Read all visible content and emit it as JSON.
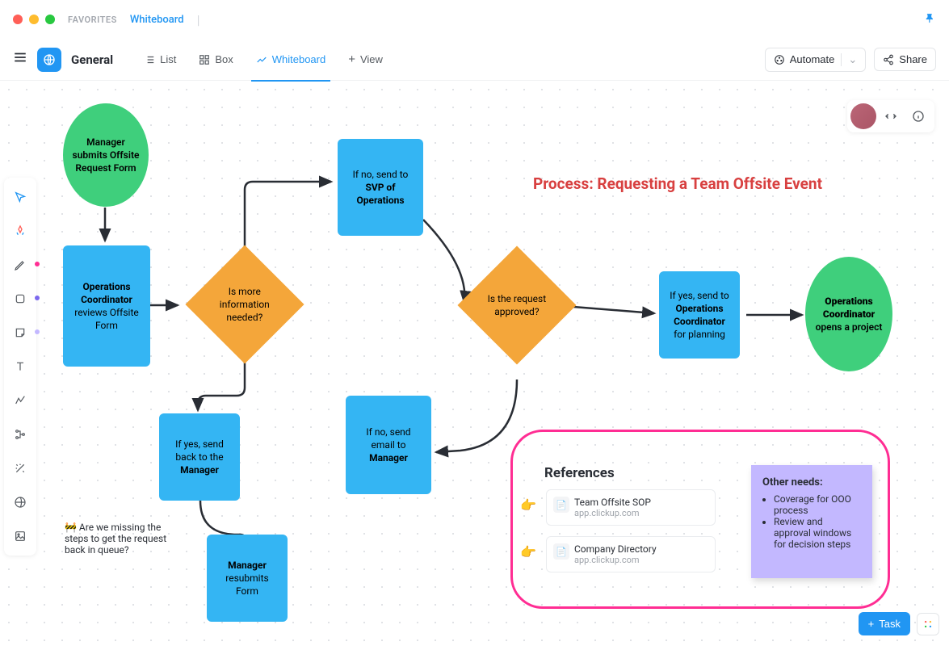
{
  "chrome": {
    "favorites": "FAVORITES",
    "tab": "Whiteboard"
  },
  "header": {
    "space": "General",
    "views": {
      "list": "List",
      "box": "Box",
      "whiteboard": "Whiteboard",
      "add": "View"
    },
    "automate": "Automate",
    "share": "Share"
  },
  "title": "Process: Requesting a Team Offsite Event",
  "nodes": {
    "start": "Manager submits Offsite Request Form",
    "review_pre": "Operations Coordinator",
    "review_post": "reviews Offsite Form",
    "d1": "Is more information needed?",
    "svp_pre": "If no, send to",
    "svp_bold": "SVP of Operations",
    "sendback_pre": "If yes, send back to the",
    "sendback_bold": "Manager",
    "resubmit_b": "Manager",
    "resubmit_post": "resubmits Form",
    "d2": "Is the request approved?",
    "deny_pre": "If no, send email to",
    "deny_bold": "Manager",
    "plan_pre": "If yes, send to",
    "plan_bold": "Operations Coordinator",
    "plan_post": "for planning",
    "end_b": "Operations Coordinator",
    "end_post": "opens a project"
  },
  "comment": "🚧 Are we missing the steps to get the request back in queue?",
  "references": {
    "heading": "References",
    "r1": {
      "title": "Team Offsite SOP",
      "sub": "app.clickup.com"
    },
    "r2": {
      "title": "Company Directory",
      "sub": "app.clickup.com"
    }
  },
  "sticky": {
    "title": "Other needs:",
    "i1": "Coverage for OOO process",
    "i2": "Review and approval windows for decision steps"
  },
  "task_btn": "Task"
}
